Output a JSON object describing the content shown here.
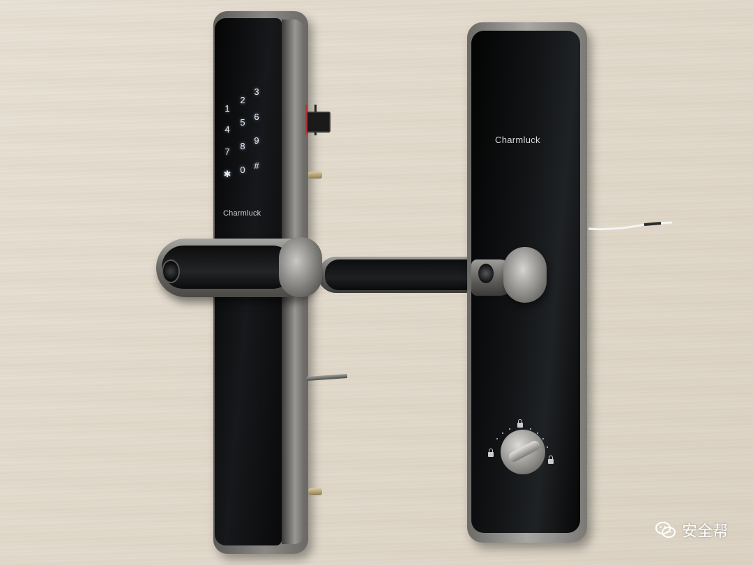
{
  "photo": {
    "subject": "smart door lock",
    "left_lock": {
      "brand": "Charmluck",
      "keypad_keys": [
        "1",
        "2",
        "3",
        "4",
        "5",
        "6",
        "7",
        "8",
        "9",
        "✱",
        "0",
        "#"
      ]
    },
    "right_lock": {
      "brand": "Charmluck"
    }
  },
  "watermark": {
    "text": "安全帮",
    "icon": "wechat-icon"
  }
}
